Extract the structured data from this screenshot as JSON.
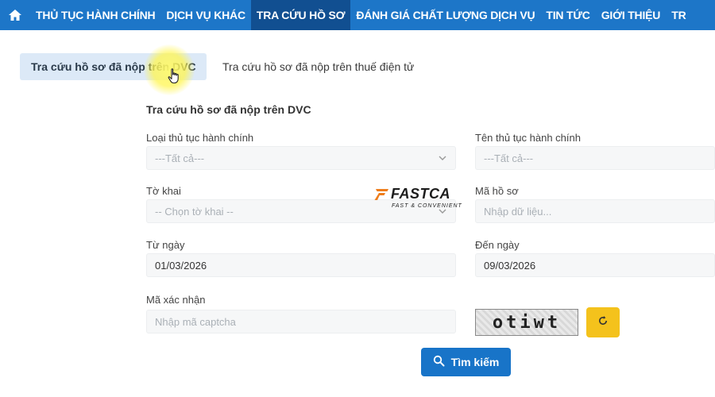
{
  "nav": {
    "items": [
      {
        "label": "THỦ TỤC HÀNH CHÍNH",
        "active": false
      },
      {
        "label": "DỊCH VỤ KHÁC",
        "active": false
      },
      {
        "label": "TRA CỨU HỒ SƠ",
        "active": true
      },
      {
        "label": "ĐÁNH GIÁ CHẤT LƯỢNG DỊCH VỤ",
        "active": false
      },
      {
        "label": "TIN TỨC",
        "active": false
      },
      {
        "label": "GIỚI THIỆU",
        "active": false
      },
      {
        "label": "TR",
        "active": false
      }
    ]
  },
  "tabs": {
    "active": "Tra cứu hồ sơ đã nộp trên DVC",
    "inactive": "Tra cứu hồ sơ đã nộp trên thuế điện tử"
  },
  "form": {
    "title": "Tra cứu hồ sơ đã nộp trên DVC",
    "procedure_type": {
      "label": "Loại thủ tục hành chính",
      "value": "---Tất cả---"
    },
    "procedure_name": {
      "label": "Tên thủ tục hành chính",
      "value": "---Tất cả---"
    },
    "declaration": {
      "label": "Tờ khai",
      "value": "-- Chọn tờ khai --"
    },
    "file_code": {
      "label": "Mã hồ sơ",
      "placeholder": "Nhập dữ liệu..."
    },
    "from_date": {
      "label": "Từ ngày",
      "value": "01/03/2026"
    },
    "to_date": {
      "label": "Đến ngày",
      "value": "09/03/2026"
    },
    "captcha": {
      "label": "Mã xác nhận",
      "placeholder": "Nhập mã captcha",
      "image_text": "otiwt"
    },
    "search_label": "Tìm kiếm"
  },
  "watermark": {
    "name": "FASTCA",
    "tagline": "FAST & CONVENIENT"
  },
  "colors": {
    "nav_bg": "#1d76c8",
    "nav_active_bg": "#114f91",
    "tab_active_bg": "#dce9f7",
    "search_button": "#1874c8",
    "refresh_button": "#f4c21c"
  }
}
